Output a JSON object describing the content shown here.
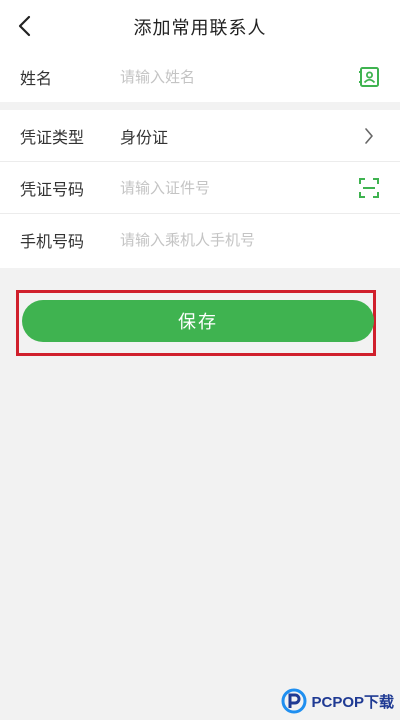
{
  "header": {
    "title": "添加常用联系人"
  },
  "form": {
    "name": {
      "label": "姓名",
      "placeholder": "请输入姓名",
      "value": ""
    },
    "id_type": {
      "label": "凭证类型",
      "value": "身份证"
    },
    "id_number": {
      "label": "凭证号码",
      "placeholder": "请输入证件号",
      "value": ""
    },
    "phone": {
      "label": "手机号码",
      "placeholder": "请输入乘机人手机号",
      "value": ""
    }
  },
  "actions": {
    "save_label": "保存"
  },
  "watermark": {
    "text": "PCPOP下载"
  },
  "colors": {
    "accent": "#3fb350",
    "highlight_frame": "#d0202c",
    "background": "#f2f2f2"
  },
  "icons": {
    "back": "chevron-left-icon",
    "contact_book": "contact-book-icon",
    "chevron_right": "chevron-right-icon",
    "scan": "scan-icon"
  }
}
